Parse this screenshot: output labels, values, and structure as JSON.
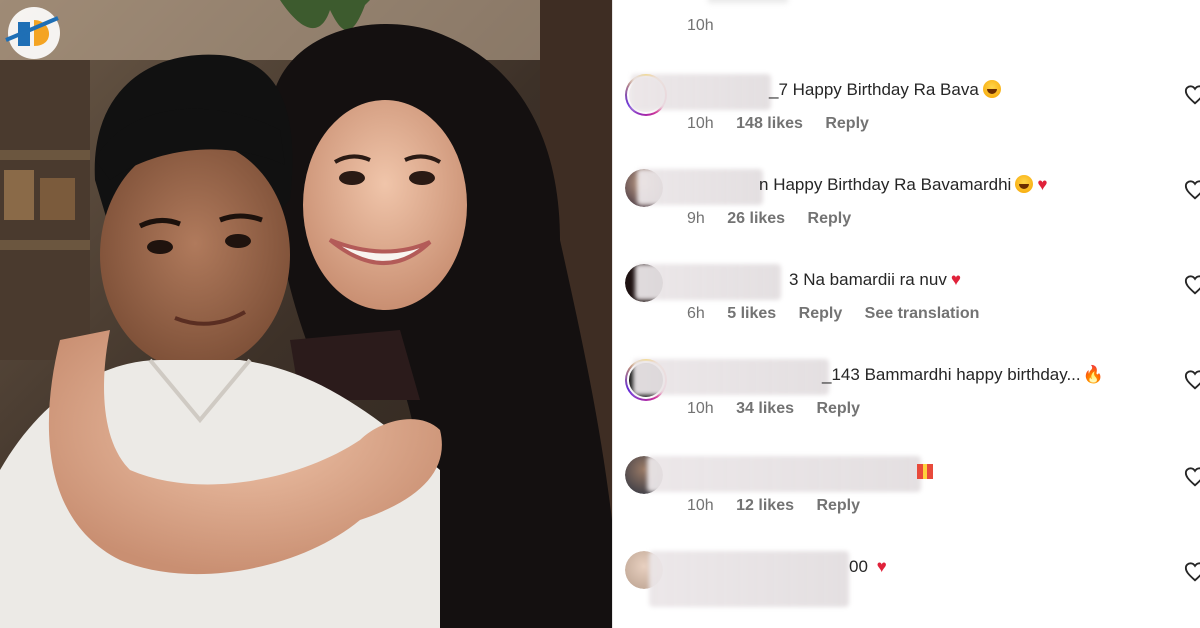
{
  "photo": {
    "logo_icon": "brand-logo-icon"
  },
  "top": {
    "time": "10h"
  },
  "comments": [
    {
      "suffix": "_7",
      "text": "Happy Birthday Ra Bava",
      "emoji": [
        "laugh"
      ],
      "time": "10h",
      "likes": "148 likes",
      "reply": "Reply",
      "translate": ""
    },
    {
      "suffix": "n",
      "text": "Happy Birthday Ra Bavamardhi",
      "emoji": [
        "laugh",
        "heart"
      ],
      "time": "9h",
      "likes": "26 likes",
      "reply": "Reply",
      "translate": ""
    },
    {
      "suffix": "3",
      "text": "Na bamardii ra nuv",
      "emoji": [
        "heart"
      ],
      "time": "6h",
      "likes": "5 likes",
      "reply": "Reply",
      "translate": "See translation"
    },
    {
      "suffix": "_143",
      "text": "Bammardhi happy birthday...",
      "emoji": [
        "fire"
      ],
      "time": "10h",
      "likes": "34 likes",
      "reply": "Reply",
      "translate": ""
    },
    {
      "suffix": "",
      "text": "",
      "emoji": [
        "gift"
      ],
      "time": "10h",
      "likes": "12 likes",
      "reply": "Reply",
      "translate": ""
    },
    {
      "suffix": "00",
      "text": "",
      "emoji": [
        "heart"
      ],
      "time": "",
      "likes": "",
      "reply": "",
      "translate": ""
    }
  ],
  "icons": {
    "like": "heart-outline-icon"
  },
  "colors": {
    "text": "#262626",
    "meta": "#737373",
    "heart": "#e0223a"
  }
}
